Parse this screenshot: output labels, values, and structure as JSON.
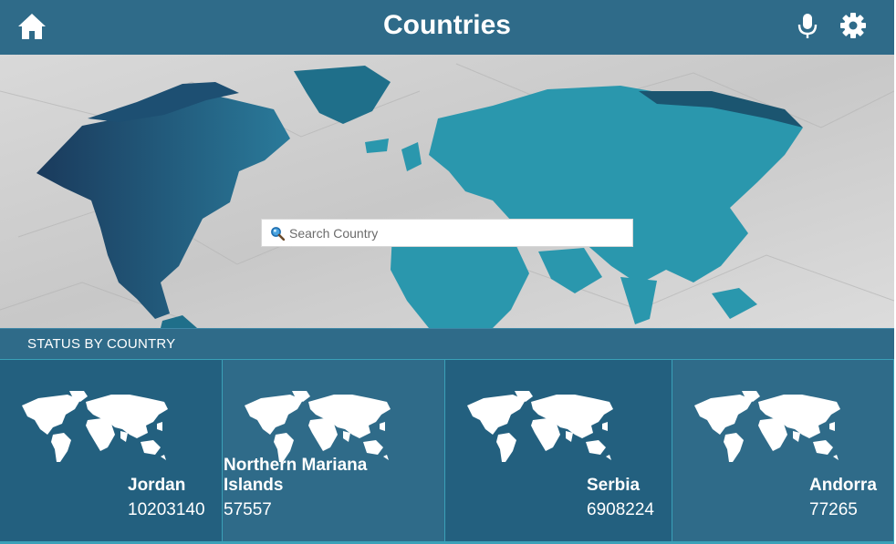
{
  "header": {
    "title": "Countries",
    "icons": {
      "home": "home-icon",
      "mic": "microphone-icon",
      "settings": "gear-icon"
    }
  },
  "search": {
    "placeholder": "Search Country",
    "value": "",
    "icon": "search-icon"
  },
  "section": {
    "label": "STATUS BY COUNTRY"
  },
  "cards": [
    {
      "name": "Jordan",
      "count": "10203140"
    },
    {
      "name": "Northern Mariana Islands",
      "count": "57557"
    },
    {
      "name": "Serbia",
      "count": "6908224"
    },
    {
      "name": "Andorra",
      "count": "77265"
    }
  ],
  "colors": {
    "header_bg": "#2f6b89",
    "card_dark": "#23607f",
    "card_light": "#2f6b89",
    "accent_line": "#3aa0b8",
    "map_teal": "#2a97ad"
  }
}
